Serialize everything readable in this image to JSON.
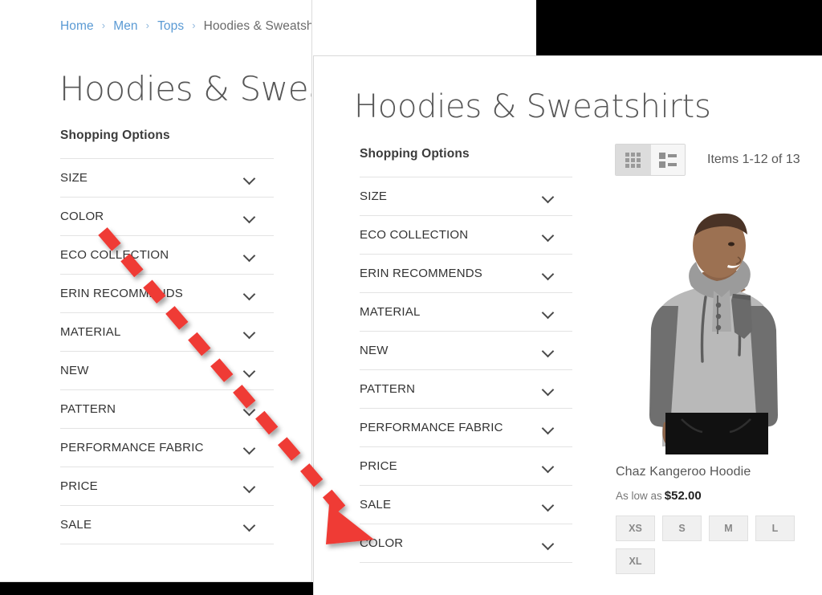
{
  "breadcrumb": {
    "separator": "›",
    "items": [
      {
        "label": "Home",
        "link": true
      },
      {
        "label": "Men",
        "link": true
      },
      {
        "label": "Tops",
        "link": true
      },
      {
        "label": "Hoodies & Sweatshirts",
        "link": false
      }
    ]
  },
  "page": {
    "title": "Hoodies & Sweatshirts"
  },
  "sidebar": {
    "heading": "Shopping Options",
    "filters_before": [
      "SIZE",
      "COLOR",
      "ECO COLLECTION",
      "ERIN RECOMMENDS",
      "MATERIAL",
      "NEW",
      "PATTERN",
      "PERFORMANCE FABRIC",
      "PRICE",
      "SALE"
    ],
    "filters_after": [
      "SIZE",
      "ECO COLLECTION",
      "ERIN RECOMMENDS",
      "MATERIAL",
      "NEW",
      "PATTERN",
      "PERFORMANCE FABRIC",
      "PRICE",
      "SALE",
      "COLOR"
    ]
  },
  "toolbar": {
    "grid_view_label": "Grid",
    "list_view_label": "List",
    "active_view": "list",
    "items_count": "Items 1-12 of 13"
  },
  "product": {
    "name": "Chaz Kangeroo Hoodie",
    "price_prefix": "As low as",
    "price": "$52.00",
    "sizes": [
      "XS",
      "S",
      "M",
      "L",
      "XL"
    ]
  },
  "annotation": {
    "color": "#ef3b36",
    "description": "dashed arrow from COLOR filter to its new position at bottom"
  },
  "colors": {
    "link": "#5a9ad4",
    "text": "#575757",
    "heading": "#3b3b3b",
    "divider": "#e3e3e3",
    "frame": "#000000",
    "arrow": "#ef3b36"
  }
}
